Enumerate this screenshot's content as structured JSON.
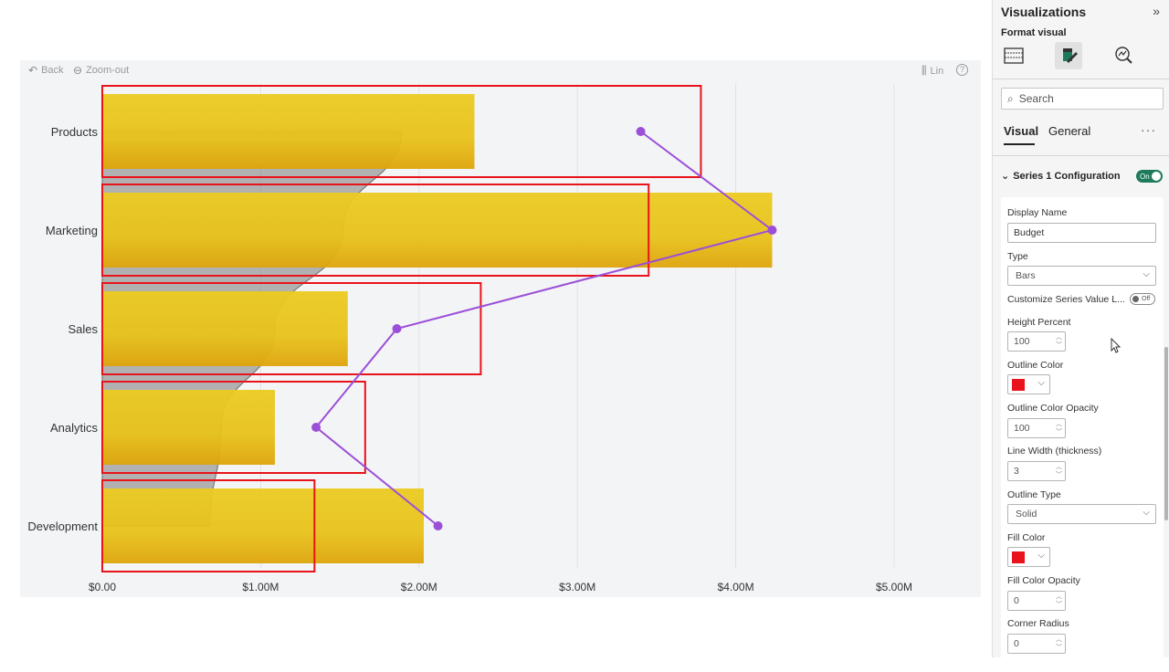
{
  "visual_header": {
    "back_label": "Back",
    "zoom_label": "Zoom-out",
    "lin_label": "Lin",
    "help_label": "?"
  },
  "chart_data": {
    "type": "bar",
    "orientation": "horizontal",
    "categories": [
      "Products",
      "Marketing",
      "Sales",
      "Analytics",
      "Development"
    ],
    "series": [
      {
        "values": [
          2.35,
          4.23,
          1.55,
          1.09,
          2.03
        ],
        "color": "#e8c21a",
        "kind": "bar"
      },
      {
        "values": [
          3.78,
          3.45,
          2.39,
          1.66,
          1.34
        ],
        "color": "#e8131b",
        "kind": "outline-bar"
      },
      {
        "values": [
          3.4,
          4.23,
          1.86,
          1.35,
          2.12
        ],
        "color": "#9b4fd8",
        "kind": "line"
      },
      {
        "values": [
          1.89,
          1.52,
          1.09,
          0.75,
          0.68
        ],
        "color": "#7a7a7a",
        "kind": "area"
      }
    ],
    "xticks": [
      "$0.00",
      "$1.00M",
      "$2.00M",
      "$3.00M",
      "$4.00M",
      "$5.00M"
    ],
    "xlim": [
      0,
      5
    ],
    "grid": true
  },
  "pane": {
    "title": "Visualizations",
    "collapse_glyph": "»",
    "subtitle": "Format visual",
    "search_placeholder": "Search",
    "tabs": [
      "Visual",
      "General"
    ],
    "more": "···",
    "section_title": "Series 1 Configuration",
    "section_toggle": "On",
    "fields": {
      "display_name_label": "Display Name",
      "display_name_value": "Budget",
      "type_label": "Type",
      "type_value": "Bars",
      "customize_label": "Customize Series Value L...",
      "customize_toggle": "Off",
      "height_percent_label": "Height Percent",
      "height_percent_value": "100",
      "outline_color_label": "Outline Color",
      "outline_opacity_label": "Outline Color Opacity",
      "outline_opacity_value": "100",
      "line_width_label": "Line Width (thickness)",
      "line_width_value": "3",
      "outline_type_label": "Outline Type",
      "outline_type_value": "Solid",
      "fill_color_label": "Fill Color",
      "fill_opacity_label": "Fill Color Opacity",
      "fill_opacity_value": "0",
      "corner_radius_label": "Corner Radius",
      "corner_radius_value": "0"
    },
    "colors": {
      "outline": "#e8131b",
      "fill": "#e8131b",
      "toggle_on": "#1d7b5c"
    }
  }
}
